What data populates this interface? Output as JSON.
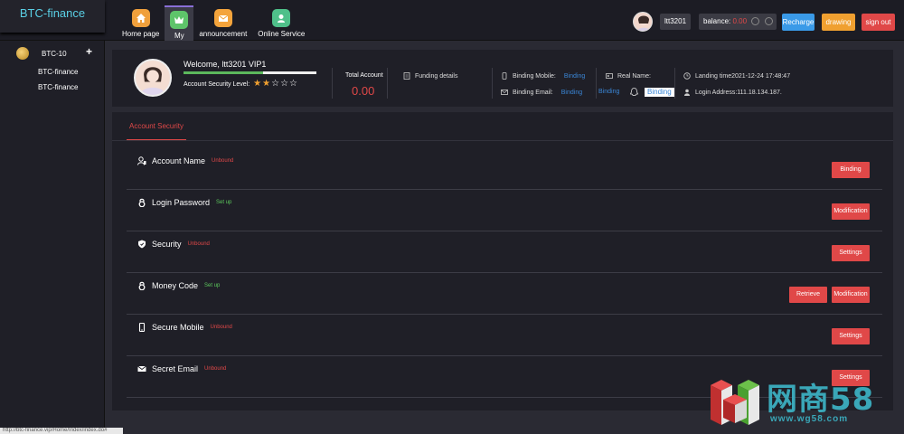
{
  "header": {
    "brand": "BTC-finance",
    "nav": [
      {
        "label": "Home page",
        "icon": "home-icon"
      },
      {
        "label": "My",
        "icon": "crown-icon"
      },
      {
        "label": "announcement",
        "icon": "mail-icon"
      },
      {
        "label": "Online Service",
        "icon": "support-icon"
      }
    ],
    "username": "ltt3201",
    "balance_label": "balance:",
    "balance_value": "0.00",
    "recharge": "Recharge",
    "drawing": "drawing",
    "sign_out": "sign out"
  },
  "sidebar": {
    "market": "BTC-10",
    "add": "+",
    "items": [
      "BTC-finance",
      "BTC-finance"
    ]
  },
  "profile": {
    "welcome": "Welcome, ltt3201 VIP1",
    "security_label": "Account Security Level:",
    "security_level": 0.6,
    "stars_on": 2,
    "stars_total": 5,
    "total_label": "Total Account",
    "total_value": "0.00",
    "funding": "Funding details",
    "binding_mobile_label": "Binding Mobile:",
    "binding_mobile_value": "Binding",
    "binding_email_label": "Binding Email:",
    "binding_email_value": "Binding",
    "real_name_label": "Real Name:",
    "binding_link": "Binding",
    "binding_box": "Binding",
    "landing_time": "Landing time2021-12-24 17:48:47",
    "login_address": "Login Address:111.18.134.187."
  },
  "security": {
    "tab": "Account Security",
    "rows": [
      {
        "title": "Account Name",
        "status": "Unbound",
        "status_type": "red",
        "buttons": [
          "Binding"
        ]
      },
      {
        "title": "Login Password",
        "status": "Set up",
        "status_type": "green",
        "buttons": [
          "Modification"
        ]
      },
      {
        "title": "Security",
        "status": "Unbound",
        "status_type": "red",
        "buttons": [
          "Settings"
        ]
      },
      {
        "title": "Money Code",
        "status": "Set up",
        "status_type": "green",
        "buttons": [
          "Retrieve",
          "Modification"
        ]
      },
      {
        "title": "Secure Mobile",
        "status": "Unbound",
        "status_type": "red",
        "buttons": [
          "Settings"
        ]
      },
      {
        "title": "Secret Email",
        "status": "Unbound",
        "status_type": "red",
        "buttons": [
          "Settings"
        ]
      }
    ]
  },
  "statusbar": "http://btc-finance.vip/Home/Index/index.do#",
  "watermark": {
    "text": "网商58",
    "url": "www.wg58.com"
  },
  "colors": {
    "accent": "#e04848",
    "link": "#3a86d6",
    "brand": "#5ad0e6",
    "recharge": "#3a9ae8",
    "drawing": "#f0a030"
  }
}
